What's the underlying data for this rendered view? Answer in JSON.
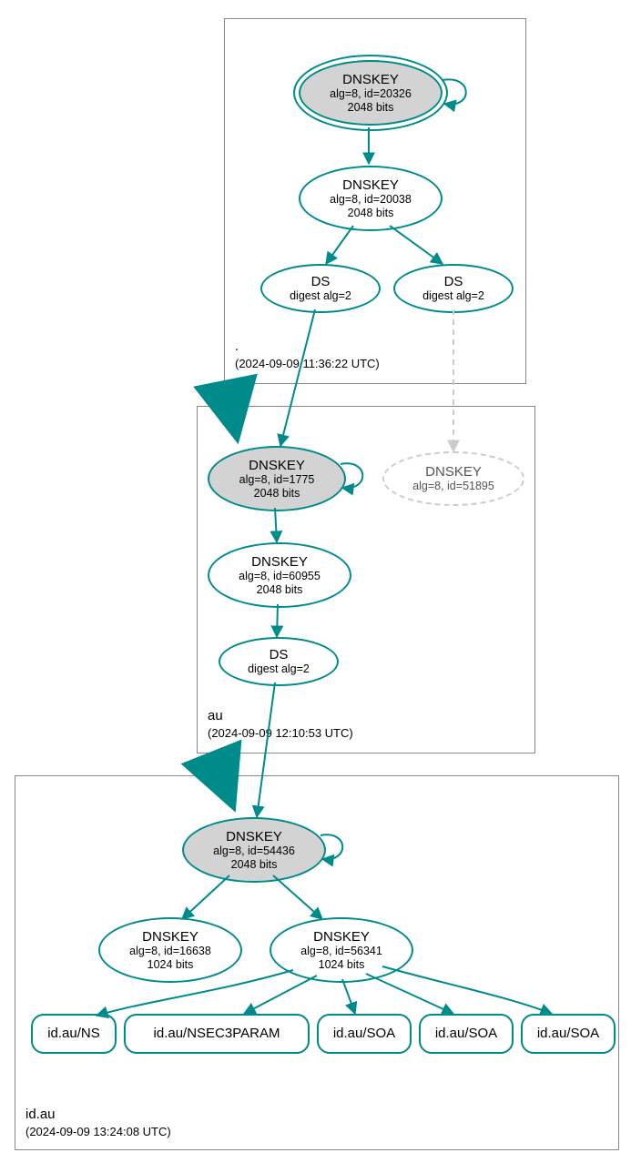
{
  "zones": {
    "root": {
      "name": ".",
      "timestamp": "(2024-09-09 11:36:22 UTC)"
    },
    "au": {
      "name": "au",
      "timestamp": "(2024-09-09 12:10:53 UTC)"
    },
    "idau": {
      "name": "id.au",
      "timestamp": "(2024-09-09 13:24:08 UTC)"
    }
  },
  "nodes": {
    "root_ksk": {
      "title": "DNSKEY",
      "sub1": "alg=8, id=20326",
      "sub2": "2048 bits"
    },
    "root_zsk": {
      "title": "DNSKEY",
      "sub1": "alg=8, id=20038",
      "sub2": "2048 bits"
    },
    "root_ds1": {
      "title": "DS",
      "sub1": "digest alg=2"
    },
    "root_ds2": {
      "title": "DS",
      "sub1": "digest alg=2"
    },
    "au_ksk": {
      "title": "DNSKEY",
      "sub1": "alg=8, id=1775",
      "sub2": "2048 bits"
    },
    "au_ghost": {
      "title": "DNSKEY",
      "sub1": "alg=8, id=51895"
    },
    "au_zsk": {
      "title": "DNSKEY",
      "sub1": "alg=8, id=60955",
      "sub2": "2048 bits"
    },
    "au_ds": {
      "title": "DS",
      "sub1": "digest alg=2"
    },
    "idau_ksk": {
      "title": "DNSKEY",
      "sub1": "alg=8, id=54436",
      "sub2": "2048 bits"
    },
    "idau_zsk1": {
      "title": "DNSKEY",
      "sub1": "alg=8, id=16638",
      "sub2": "1024 bits"
    },
    "idau_zsk2": {
      "title": "DNSKEY",
      "sub1": "alg=8, id=56341",
      "sub2": "1024 bits"
    },
    "rr_ns": {
      "label": "id.au/NS"
    },
    "rr_nsec3": {
      "label": "id.au/NSEC3PARAM"
    },
    "rr_soa1": {
      "label": "id.au/SOA"
    },
    "rr_soa2": {
      "label": "id.au/SOA"
    },
    "rr_soa3": {
      "label": "id.au/SOA"
    }
  },
  "colors": {
    "teal": "#008B8B",
    "ghost": "#cccccc"
  }
}
